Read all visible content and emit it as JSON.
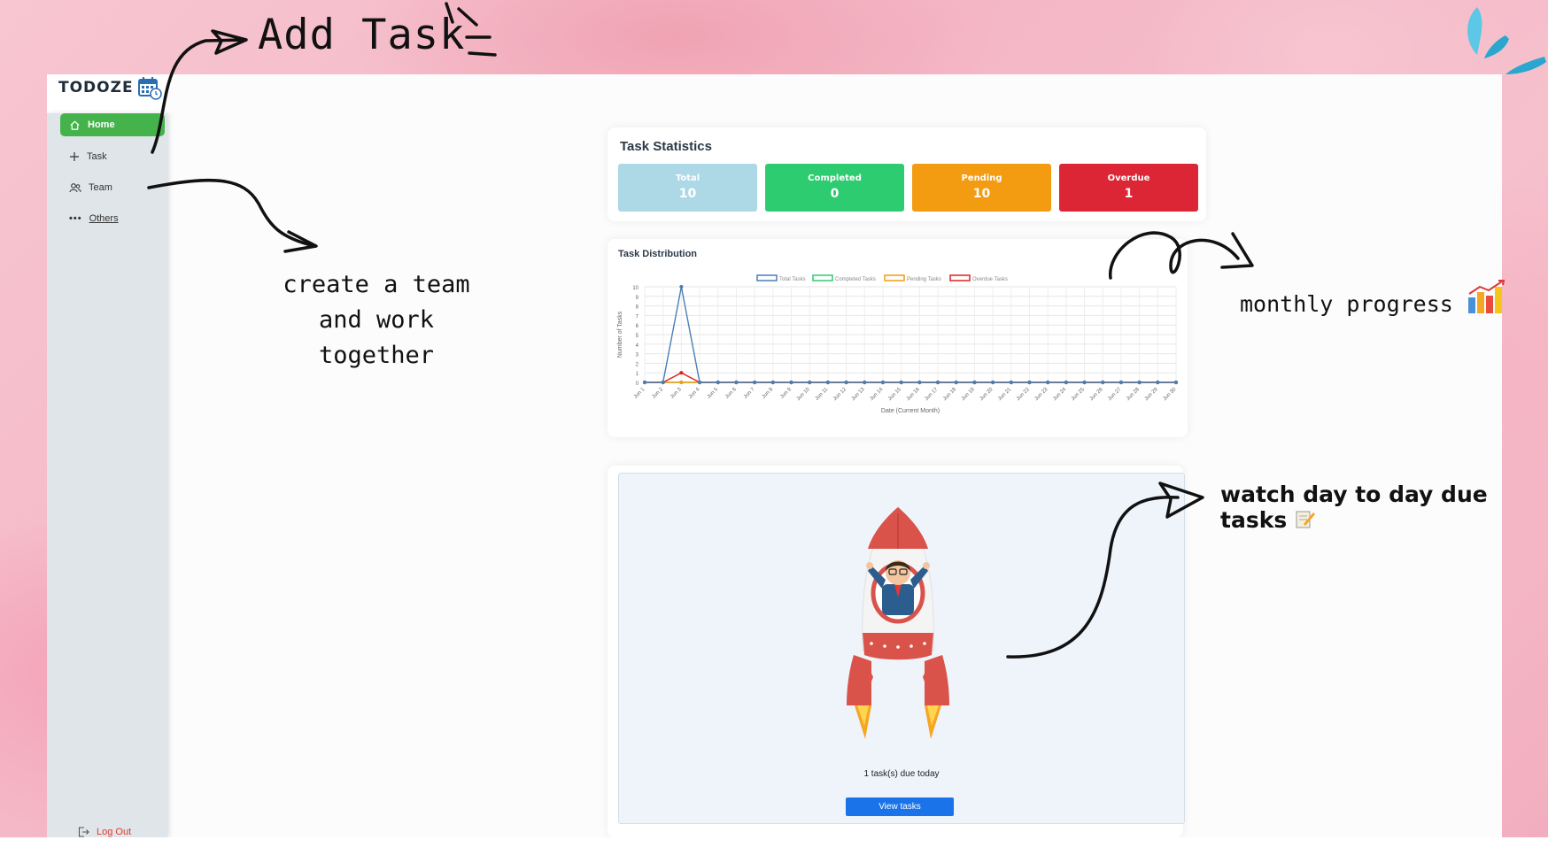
{
  "annotations": {
    "add_task": "Add Task",
    "team_line1": "create a team",
    "team_line2": "and work together",
    "monthly": "monthly progress",
    "due_tasks": "watch day to day due tasks"
  },
  "app": {
    "logo": "TODOZE"
  },
  "sidebar": {
    "items": [
      {
        "label": "Home",
        "icon": "home-icon",
        "active": true
      },
      {
        "label": "Task",
        "icon": "plus-icon"
      },
      {
        "label": "Team",
        "icon": "users-icon"
      },
      {
        "label": "Others",
        "icon": "more-icon"
      }
    ],
    "logout": "Log Out"
  },
  "stats": {
    "title": "Task Statistics",
    "cards": [
      {
        "label": "Total",
        "value": "10",
        "color": "#add8e6"
      },
      {
        "label": "Completed",
        "value": "0",
        "color": "#2ecc71"
      },
      {
        "label": "Pending",
        "value": "10",
        "color": "#f39c12"
      },
      {
        "label": "Overdue",
        "value": "1",
        "color": "#dc2535"
      }
    ]
  },
  "distribution": {
    "title": "Task Distribution",
    "chart_data": {
      "type": "line",
      "title": "Task Distribution",
      "xlabel": "Date (Current Month)",
      "ylabel": "Number of Tasks",
      "ylim": [
        0,
        10
      ],
      "yticks": [
        0,
        1,
        2,
        3,
        4,
        5,
        6,
        7,
        8,
        9,
        10
      ],
      "grid": true,
      "legend": "top",
      "categories": [
        "Jun 1",
        "Jun 2",
        "Jun 3",
        "Jun 4",
        "Jun 5",
        "Jun 6",
        "Jun 7",
        "Jun 8",
        "Jun 9",
        "Jun 10",
        "Jun 11",
        "Jun 12",
        "Jun 13",
        "Jun 14",
        "Jun 15",
        "Jun 16",
        "Jun 17",
        "Jun 18",
        "Jun 19",
        "Jun 20",
        "Jun 21",
        "Jun 22",
        "Jun 23",
        "Jun 24",
        "Jun 25",
        "Jun 26",
        "Jun 27",
        "Jun 28",
        "Jun 29",
        "Jun 30"
      ],
      "series": [
        {
          "name": "Total Tasks",
          "color": "#4a7fb5",
          "values": [
            0,
            0,
            10,
            0,
            0,
            0,
            0,
            0,
            0,
            0,
            0,
            0,
            0,
            0,
            0,
            0,
            0,
            0,
            0,
            0,
            0,
            0,
            0,
            0,
            0,
            0,
            0,
            0,
            0,
            0
          ]
        },
        {
          "name": "Completed Tasks",
          "color": "#2ecc71",
          "values": [
            0,
            0,
            0,
            0,
            0,
            0,
            0,
            0,
            0,
            0,
            0,
            0,
            0,
            0,
            0,
            0,
            0,
            0,
            0,
            0,
            0,
            0,
            0,
            0,
            0,
            0,
            0,
            0,
            0,
            0
          ]
        },
        {
          "name": "Pending Tasks",
          "color": "#f39c12",
          "values": [
            0,
            0,
            0,
            0,
            0,
            0,
            0,
            0,
            0,
            0,
            0,
            0,
            0,
            0,
            0,
            0,
            0,
            0,
            0,
            0,
            0,
            0,
            0,
            0,
            0,
            0,
            0,
            0,
            0,
            0
          ]
        },
        {
          "name": "Overdue Tasks",
          "color": "#e02020",
          "values": [
            0,
            0,
            1,
            0,
            0,
            0,
            0,
            0,
            0,
            0,
            0,
            0,
            0,
            0,
            0,
            0,
            0,
            0,
            0,
            0,
            0,
            0,
            0,
            0,
            0,
            0,
            0,
            0,
            0,
            0
          ]
        }
      ]
    }
  },
  "due": {
    "text": "1 task(s) due today",
    "button": "View tasks"
  }
}
